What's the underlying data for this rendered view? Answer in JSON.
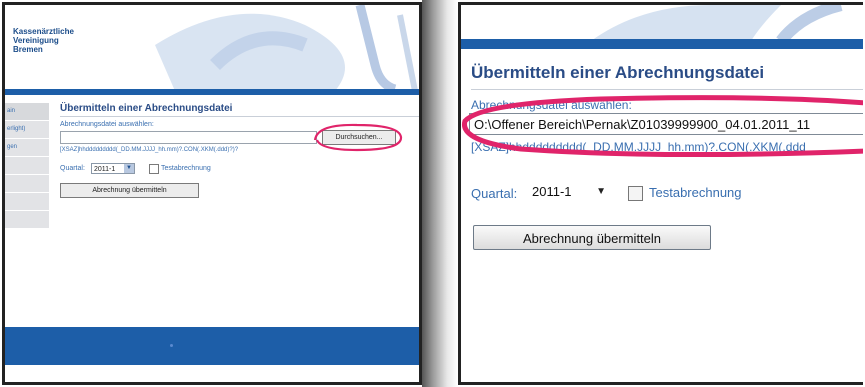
{
  "left": {
    "org_name": "Kassenärztliche\nVereinigung\nBremen",
    "nav_items": [
      "ain",
      "erlight)",
      "gen",
      "",
      "",
      "",
      ""
    ],
    "title": "Übermitteln einer Abrechnungsdatei",
    "file_label": "Abrechnungsdatei auswählen:",
    "file_value": "",
    "browse_label": "Durchsuchen...",
    "pattern": "[XSAZ]hhddddddddd(_DD.MM.JJJJ_hh.mm)?.CON(.XKM(.ddd)?)?",
    "quartal_label": "Quartal:",
    "quartal_value": "2011-1",
    "test_label": "Testabrechnung",
    "submit_label": "Abrechnung übermitteln"
  },
  "right": {
    "title": "Übermitteln einer Abrechnungsdatei",
    "file_label": "Abrechnungsdatei auswählen:",
    "file_value": "O:\\Offener Bereich\\Pernak\\Z01039999900_04.01.2011_11",
    "pattern": "[XSAZ]hhddddddddd(_DD.MM.JJJJ_hh.mm)?.CON(.XKM(.ddd",
    "quartal_label": "Quartal:",
    "quartal_value": "2011-1",
    "test_label": "Testabrechnung",
    "submit_label": "Abrechnung übermitteln"
  },
  "colors": {
    "brand_blue": "#1d5ea8",
    "highlight_pink": "#e0246a",
    "title_blue": "#2a4c86",
    "label_blue": "#3a6fb0"
  },
  "icons": [
    "chevron-down-icon",
    "checkbox-icon",
    "dropdown-arrow-icon"
  ]
}
